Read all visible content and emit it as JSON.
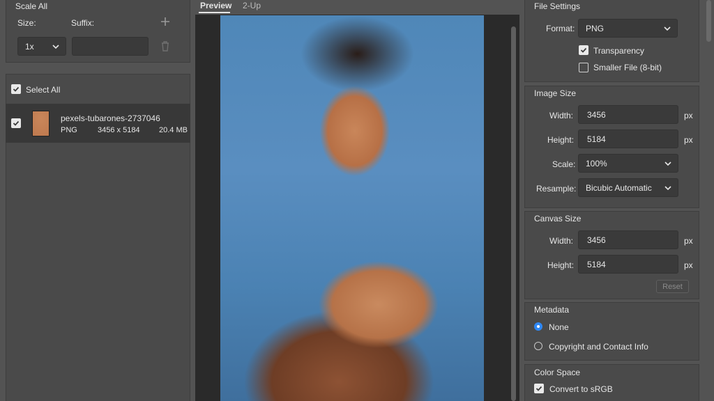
{
  "scale_panel": {
    "title": "Scale All",
    "size_label": "Size:",
    "suffix_label": "Suffix:",
    "size_value": "1x",
    "suffix_value": ""
  },
  "assets": {
    "select_all_label": "Select All",
    "items": [
      {
        "name": "pexels-tubarones-2737046",
        "format": "PNG",
        "dimensions": "3456 x 5184",
        "filesize": "20.4 MB"
      }
    ]
  },
  "preview_tabs": {
    "preview": "Preview",
    "two_up": "2-Up"
  },
  "file_settings": {
    "title": "File Settings",
    "format_label": "Format:",
    "format_value": "PNG",
    "transparency_label": "Transparency",
    "smaller_file_label": "Smaller File (8-bit)"
  },
  "image_size": {
    "title": "Image Size",
    "width_label": "Width:",
    "width_value": "3456",
    "height_label": "Height:",
    "height_value": "5184",
    "unit": "px",
    "scale_label": "Scale:",
    "scale_value": "100%",
    "resample_label": "Resample:",
    "resample_value": "Bicubic Automatic"
  },
  "canvas_size": {
    "title": "Canvas Size",
    "width_label": "Width:",
    "width_value": "3456",
    "height_label": "Height:",
    "height_value": "5184",
    "unit": "px",
    "reset_label": "Reset"
  },
  "metadata": {
    "title": "Metadata",
    "none_label": "None",
    "copyright_label": "Copyright and Contact Info"
  },
  "color_space": {
    "title": "Color Space",
    "convert_label": "Convert to sRGB"
  }
}
